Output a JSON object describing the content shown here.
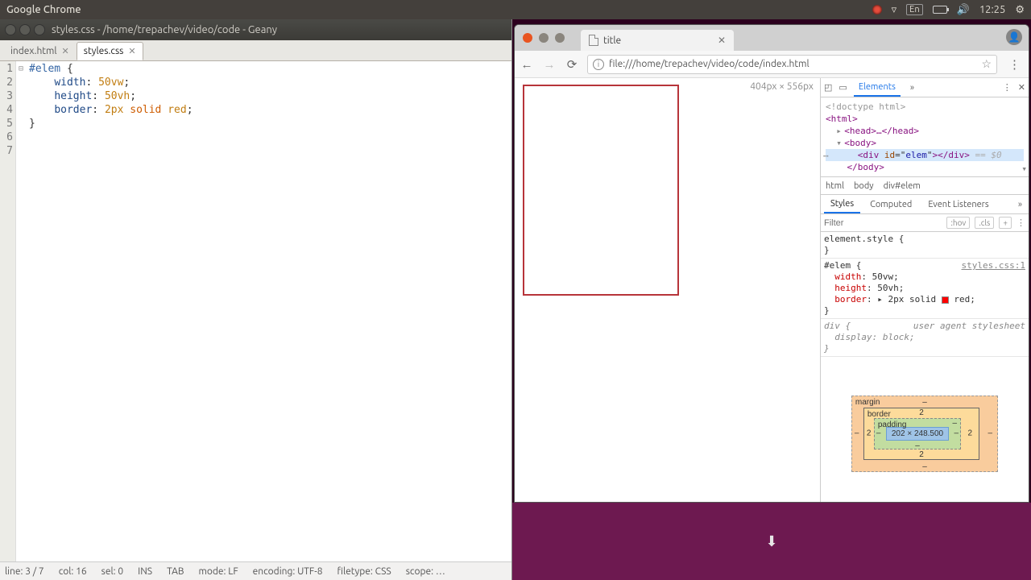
{
  "topbar": {
    "title": "Google Chrome",
    "lang": "En",
    "time": "12:25"
  },
  "geany": {
    "title": "styles.css - /home/trepachev/video/code - Geany",
    "tabs": [
      {
        "label": "index.html",
        "active": false
      },
      {
        "label": "styles.css",
        "active": true
      }
    ],
    "gutter": [
      "1",
      "2",
      "3",
      "4",
      "5",
      "6",
      "7"
    ],
    "code": {
      "l1_sel": "#elem",
      "l1_b": " {",
      "l2_p": "width",
      "l2_c": ": ",
      "l2_v": "50vw",
      "l2_e": ";",
      "l3_p": "height",
      "l3_c": ": ",
      "l3_v": "50vh",
      "l3_e": ";",
      "l4_p": "border",
      "l4_c": ": ",
      "l4_v1": "2px",
      "l4_sp": " ",
      "l4_v2": "solid",
      "l4_sp2": " ",
      "l4_v3": "red",
      "l4_e": ";",
      "l5": "}"
    },
    "status": {
      "line": "line: 3 / 7",
      "col": "col: 16",
      "sel": "sel: 0",
      "ins": "INS",
      "tab": "TAB",
      "mode": "mode: LF",
      "enc": "encoding: UTF-8",
      "ft": "filetype: CSS",
      "scope": "scope: …"
    }
  },
  "chrome": {
    "tab_title": "title",
    "url": "file:///home/trepachev/video/code/index.html",
    "viewport_dims": "404px × 556px"
  },
  "devtools": {
    "panel": "Elements",
    "dom": {
      "doctype": "<!doctype html>",
      "html_open": "<html>",
      "head": "<head>…</head>",
      "body_open": "<body>",
      "div_open": "<div ",
      "div_id_attr": "id",
      "div_id_val": "elem",
      "div_close": "></div>",
      "eq0": " == $0",
      "body_close": "</body>"
    },
    "crumbs": [
      "html",
      "body",
      "div#elem"
    ],
    "style_tabs": [
      "Styles",
      "Computed",
      "Event Listeners"
    ],
    "filter_placeholder": "Filter",
    "hov": ":hov",
    "cls": ".cls",
    "rules": {
      "r1_sel": "element.style {",
      "r1_close": "}",
      "r2_sel": "#elem {",
      "r2_src": "styles.css:1",
      "r2_p1": "width",
      "r2_v1": "50vw;",
      "r2_p2": "height",
      "r2_v2": "50vh;",
      "r2_p3": "border",
      "r2_v3": "2px solid ",
      "r2_v3b": "red;",
      "r2_close": "}",
      "r3_sel": "div {",
      "r3_ua": "user agent stylesheet",
      "r3_p1": "display",
      "r3_v1": "block;",
      "r3_close": "}"
    },
    "box": {
      "margin": "margin",
      "border": "border",
      "padding": "padding",
      "content": "202 × 248.500",
      "b_top": "2",
      "b_right": "2",
      "b_bottom": "2",
      "b_left": "2"
    }
  }
}
